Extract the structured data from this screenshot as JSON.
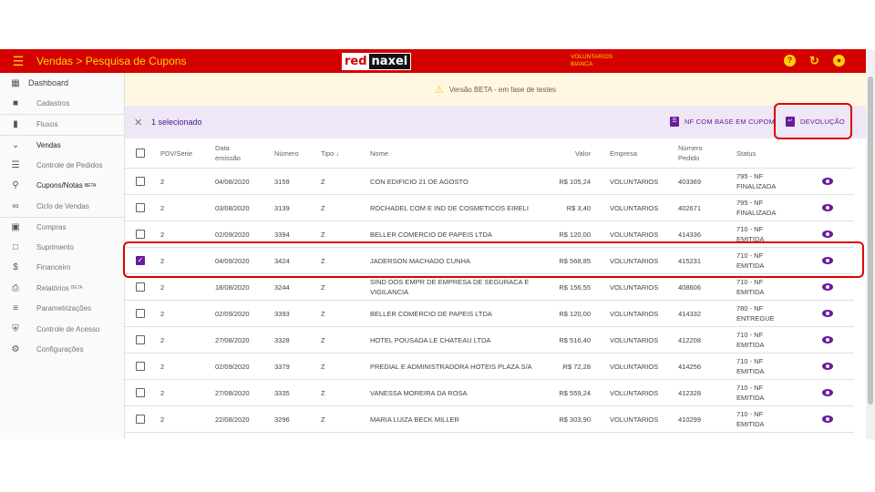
{
  "header": {
    "title": "Vendas > Pesquisa de Cupons",
    "logo_left": "red",
    "logo_right": "naxel",
    "user_line1": "VOLUNTARIOS",
    "user_line2": "BIANCA",
    "menu_icon": "menu-icon",
    "help_icon": "help-icon",
    "refresh_icon": "refresh-icon",
    "account_icon": "account-icon",
    "colors": {
      "bar": "#d50000",
      "text": "#ffd600"
    }
  },
  "sidebar": {
    "items": [
      {
        "label": "Dashboard",
        "icon": "dashboard-icon"
      },
      {
        "label": "Cadastros",
        "icon": "folder-icon"
      },
      {
        "label": "Fluxos",
        "icon": "columns-icon"
      },
      {
        "label": "Vendas",
        "icon": "chevron-down-icon"
      },
      {
        "label": "Controle de Pedidos",
        "icon": "list-icon"
      },
      {
        "label": "Cupons/Notas",
        "badge": "BETA",
        "icon": "search-icon"
      },
      {
        "label": "Ciclo de Vendas",
        "icon": "infinity-icon"
      },
      {
        "label": "Compras",
        "icon": "store-icon"
      },
      {
        "label": "Suprimento",
        "icon": "crop-icon"
      },
      {
        "label": "Financeiro",
        "icon": "money-icon"
      },
      {
        "label": "Relatórios",
        "badge": "BETA",
        "icon": "print-icon"
      },
      {
        "label": "Parametrizações",
        "icon": "tune-icon"
      },
      {
        "label": "Controle de Acesso",
        "icon": "shield-icon"
      },
      {
        "label": "Configurações",
        "icon": "gear-icon"
      }
    ]
  },
  "banner": {
    "text": "Versão BETA - em fase de testes",
    "icon": "warning-icon"
  },
  "selection": {
    "text": "1 selecionado",
    "close_icon": "close-icon",
    "action_nf": "NF COM BASE EM CUPOM",
    "action_devolucao": "DEVOLUÇÃO"
  },
  "table": {
    "headers": {
      "pdv": "PDV/Serie",
      "data_l1": "Data",
      "data_l2": "emissão",
      "numero": "Número",
      "tipo": "Tipo",
      "tipo_sort": "↓",
      "nome": "Nome",
      "valor": "Valor",
      "empresa": "Empresa",
      "pedido_l1": "Número",
      "pedido_l2": "Pedido",
      "status": "Status"
    },
    "rows": [
      {
        "checked": false,
        "pdv": "2",
        "data": "04/08/2020",
        "numero": "3159",
        "tipo": "Z",
        "nome_l1": "CON EDIFICIO 21 DE AGOSTO",
        "nome_l2": "",
        "valor": "R$ 105,24",
        "empresa": "VOLUNTARIOS",
        "pedido": "403369",
        "status_l1": "795 - NF",
        "status_l2": "FINALIZADA"
      },
      {
        "checked": false,
        "pdv": "2",
        "data": "03/08/2020",
        "numero": "3139",
        "tipo": "Z",
        "nome_l1": "ROCHADEL COM E IND DE COSMETICOS EIRELI",
        "nome_l2": "",
        "valor": "R$ 3,40",
        "empresa": "VOLUNTARIOS",
        "pedido": "402671",
        "status_l1": "795 - NF",
        "status_l2": "FINALIZADA"
      },
      {
        "checked": false,
        "pdv": "2",
        "data": "02/09/2020",
        "numero": "3394",
        "tipo": "Z",
        "nome_l1": "BELLER COMERCIO DE PAPEIS LTDA",
        "nome_l2": "",
        "valor": "R$ 120,00",
        "empresa": "VOLUNTARIOS",
        "pedido": "414336",
        "status_l1": "710 - NF",
        "status_l2": "EMITIDA"
      },
      {
        "checked": true,
        "pdv": "2",
        "data": "04/09/2020",
        "numero": "3424",
        "tipo": "Z",
        "nome_l1": "JADERSON MACHADO CUNHA",
        "nome_l2": "",
        "valor": "R$ 568,85",
        "empresa": "VOLUNTARIOS",
        "pedido": "415231",
        "status_l1": "710 - NF",
        "status_l2": "EMITIDA"
      },
      {
        "checked": false,
        "pdv": "2",
        "data": "18/08/2020",
        "numero": "3244",
        "tipo": "Z",
        "nome_l1": "SIND DOS EMPR DE EMPRESA DE SEGURACA E",
        "nome_l2": "VIGILANCIA",
        "valor": "R$ 156,55",
        "empresa": "VOLUNTARIOS",
        "pedido": "408606",
        "status_l1": "710 - NF",
        "status_l2": "EMITIDA"
      },
      {
        "checked": false,
        "pdv": "2",
        "data": "02/09/2020",
        "numero": "3393",
        "tipo": "Z",
        "nome_l1": "BELLER COMERCIO DE PAPEIS LTDA",
        "nome_l2": "",
        "valor": "R$ 120,00",
        "empresa": "VOLUNTARIOS",
        "pedido": "414332",
        "status_l1": "780 - NF",
        "status_l2": "ENTREGUE"
      },
      {
        "checked": false,
        "pdv": "2",
        "data": "27/08/2020",
        "numero": "3328",
        "tipo": "Z",
        "nome_l1": "HOTEL POUSADA LE CHATEAU LTDA",
        "nome_l2": "",
        "valor": "R$ 516,40",
        "empresa": "VOLUNTARIOS",
        "pedido": "412208",
        "status_l1": "710 - NF",
        "status_l2": "EMITIDA"
      },
      {
        "checked": false,
        "pdv": "2",
        "data": "02/09/2020",
        "numero": "3379",
        "tipo": "Z",
        "nome_l1": "PREDIAL E ADMINISTRADORA HOTEIS PLAZA S/A",
        "nome_l2": "",
        "valor": "R$ 72,28",
        "empresa": "VOLUNTARIOS",
        "pedido": "414256",
        "status_l1": "710 - NF",
        "status_l2": "EMITIDA"
      },
      {
        "checked": false,
        "pdv": "2",
        "data": "27/08/2020",
        "numero": "3335",
        "tipo": "Z",
        "nome_l1": "VANESSA MOREIRA DA ROSA",
        "nome_l2": "",
        "valor": "R$ 559,24",
        "empresa": "VOLUNTARIOS",
        "pedido": "412328",
        "status_l1": "710 - NF",
        "status_l2": "EMITIDA"
      },
      {
        "checked": false,
        "pdv": "2",
        "data": "22/08/2020",
        "numero": "3296",
        "tipo": "Z",
        "nome_l1": "MARIA LUIZA BECK MILLER",
        "nome_l2": "",
        "valor": "R$ 303,90",
        "empresa": "VOLUNTARIOS",
        "pedido": "410299",
        "status_l1": "710 - NF",
        "status_l2": "EMITIDA"
      }
    ]
  }
}
